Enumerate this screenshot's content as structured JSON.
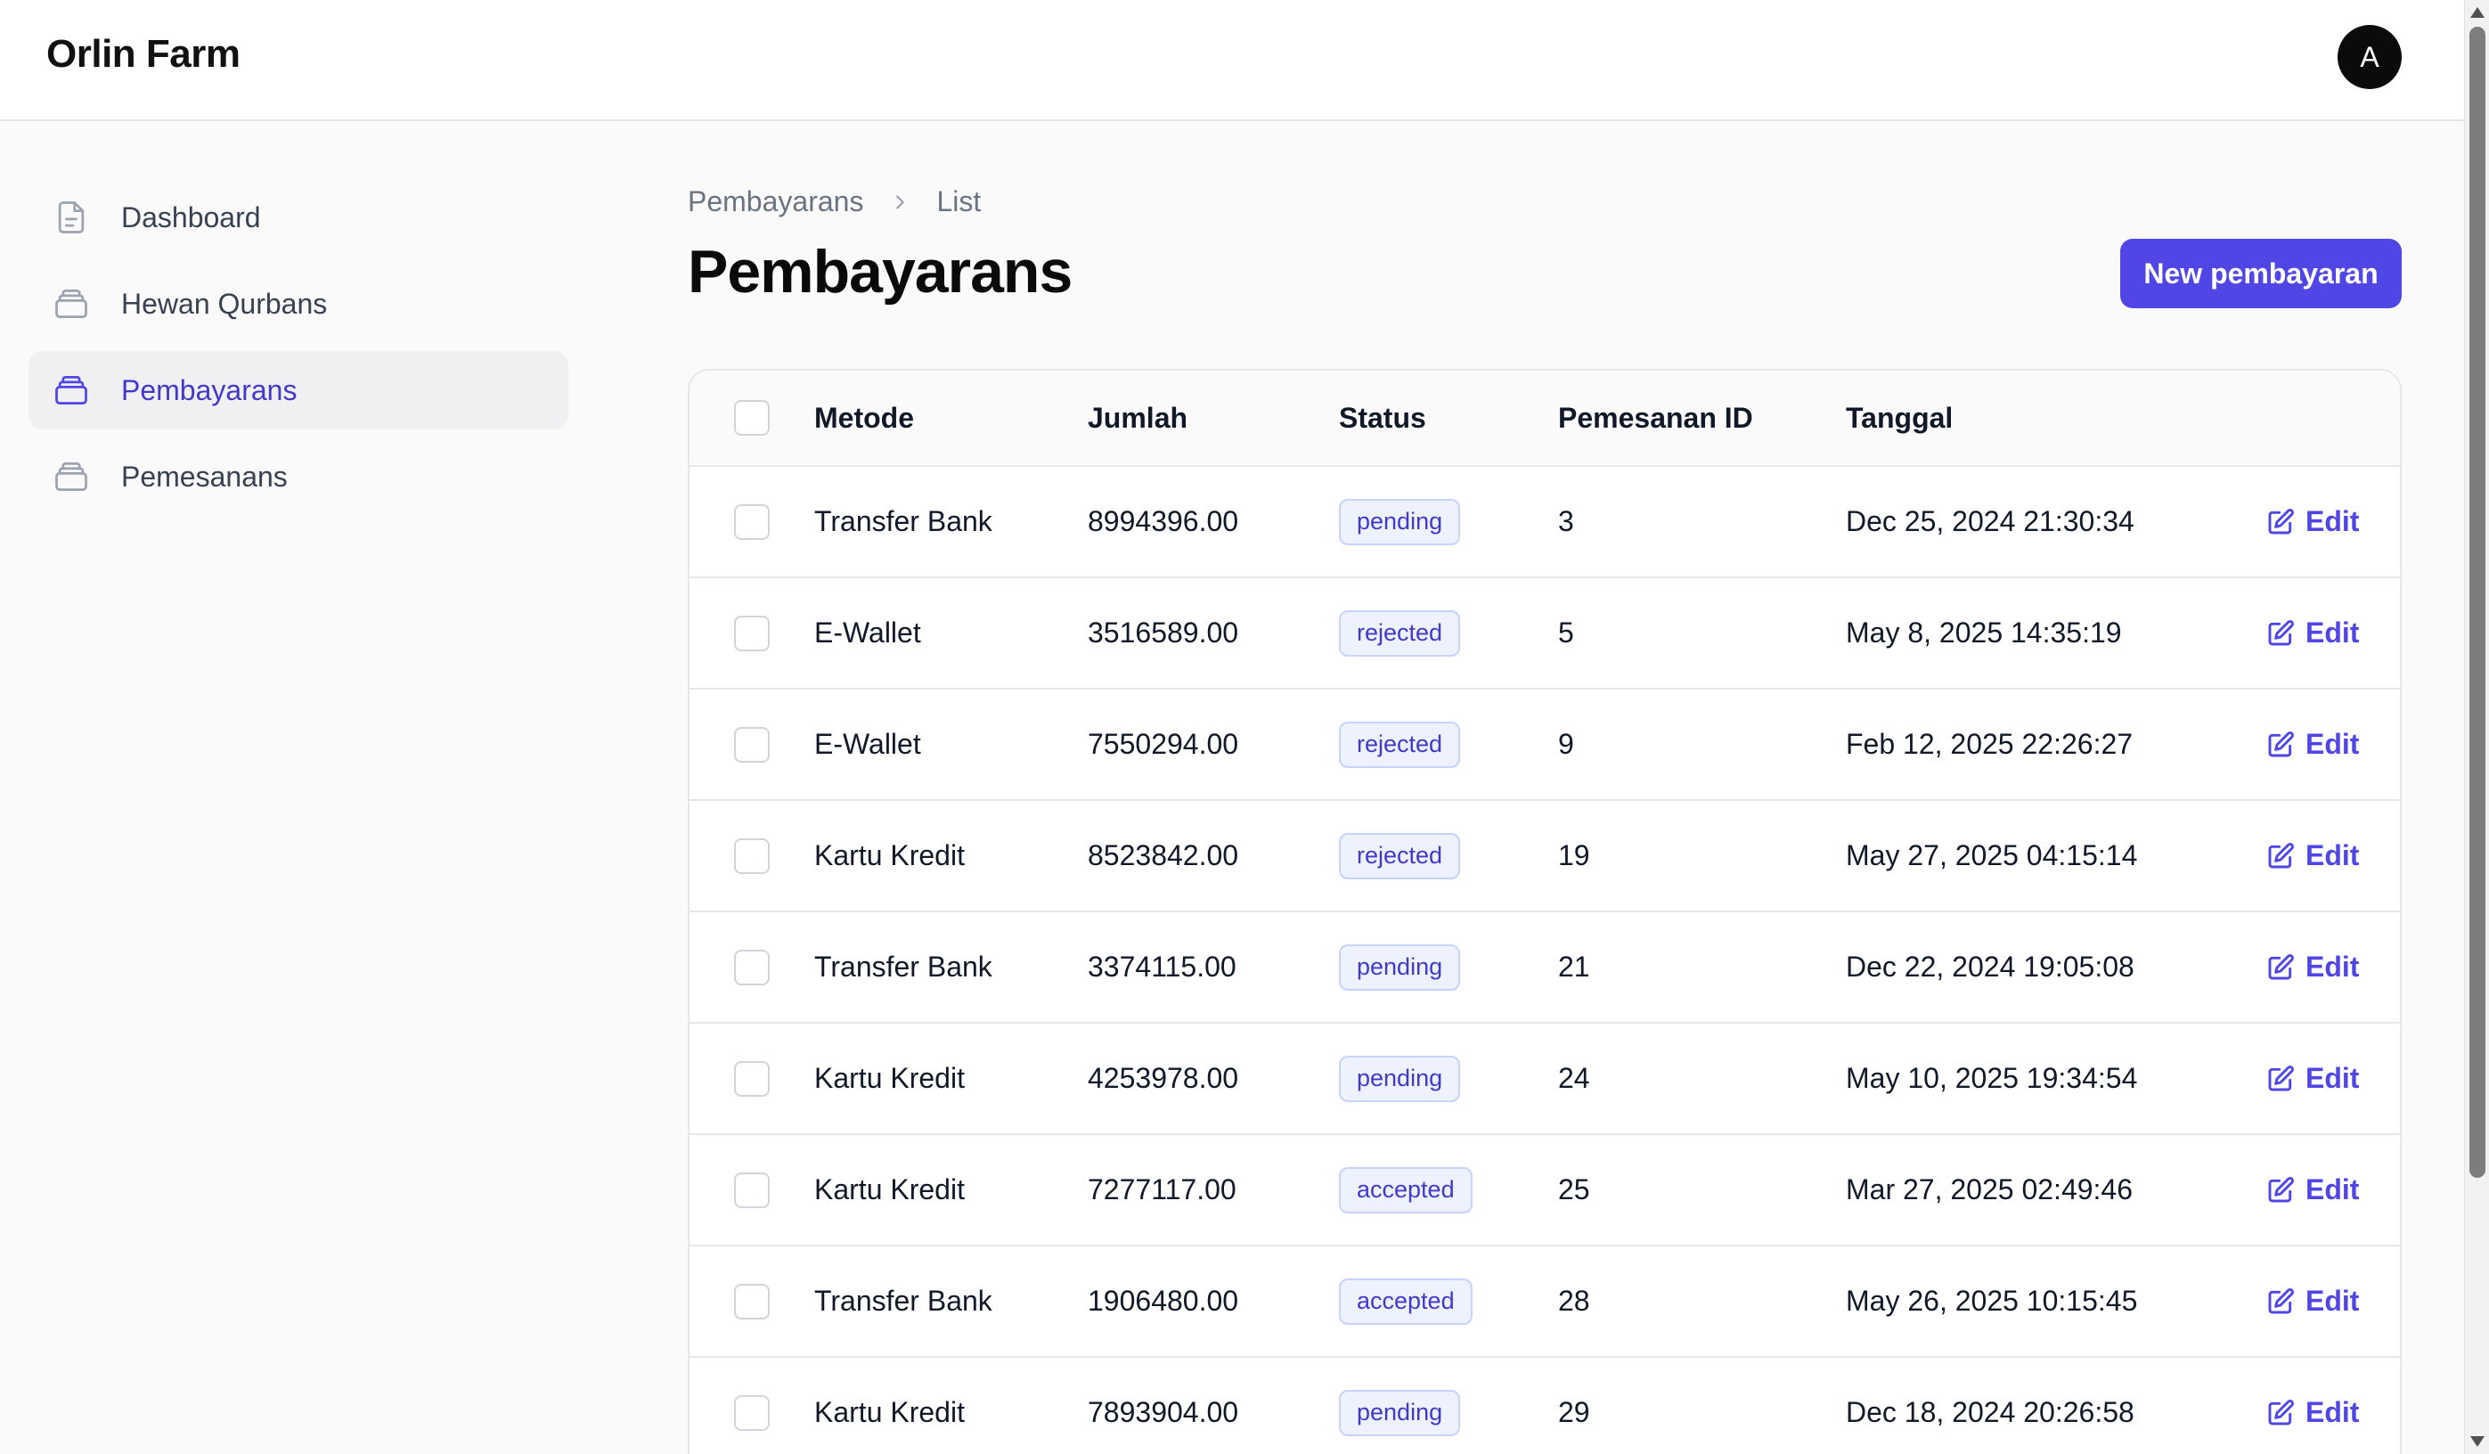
{
  "app": {
    "brand": "Orlin Farm",
    "avatar_initial": "A"
  },
  "sidebar": {
    "items": [
      {
        "label": "Dashboard",
        "icon": "document-icon",
        "active": false
      },
      {
        "label": "Hewan Qurbans",
        "icon": "collection-icon",
        "active": false
      },
      {
        "label": "Pembayarans",
        "icon": "collection-icon",
        "active": true
      },
      {
        "label": "Pemesanans",
        "icon": "collection-icon",
        "active": false
      }
    ]
  },
  "breadcrumb": {
    "parent": "Pembayarans",
    "current": "List"
  },
  "page": {
    "title": "Pembayarans",
    "new_button": "New pembayaran"
  },
  "table": {
    "headers": {
      "metode": "Metode",
      "jumlah": "Jumlah",
      "status": "Status",
      "pemesanan_id": "Pemesanan ID",
      "tanggal": "Tanggal"
    },
    "edit_label": "Edit",
    "rows": [
      {
        "metode": "Transfer Bank",
        "jumlah": "8994396.00",
        "status": "pending",
        "pemesanan_id": "3",
        "tanggal": "Dec 25, 2024 21:30:34"
      },
      {
        "metode": "E-Wallet",
        "jumlah": "3516589.00",
        "status": "rejected",
        "pemesanan_id": "5",
        "tanggal": "May 8, 2025 14:35:19"
      },
      {
        "metode": "E-Wallet",
        "jumlah": "7550294.00",
        "status": "rejected",
        "pemesanan_id": "9",
        "tanggal": "Feb 12, 2025 22:26:27"
      },
      {
        "metode": "Kartu Kredit",
        "jumlah": "8523842.00",
        "status": "rejected",
        "pemesanan_id": "19",
        "tanggal": "May 27, 2025 04:15:14"
      },
      {
        "metode": "Transfer Bank",
        "jumlah": "3374115.00",
        "status": "pending",
        "pemesanan_id": "21",
        "tanggal": "Dec 22, 2024 19:05:08"
      },
      {
        "metode": "Kartu Kredit",
        "jumlah": "4253978.00",
        "status": "pending",
        "pemesanan_id": "24",
        "tanggal": "May 10, 2025 19:34:54"
      },
      {
        "metode": "Kartu Kredit",
        "jumlah": "7277117.00",
        "status": "accepted",
        "pemesanan_id": "25",
        "tanggal": "Mar 27, 2025 02:49:46"
      },
      {
        "metode": "Transfer Bank",
        "jumlah": "1906480.00",
        "status": "accepted",
        "pemesanan_id": "28",
        "tanggal": "May 26, 2025 10:15:45"
      },
      {
        "metode": "Kartu Kredit",
        "jumlah": "7893904.00",
        "status": "pending",
        "pemesanan_id": "29",
        "tanggal": "Dec 18, 2024 20:26:58"
      }
    ]
  },
  "colors": {
    "accent": "#4f46e5",
    "active_nav": "#4338ca"
  }
}
